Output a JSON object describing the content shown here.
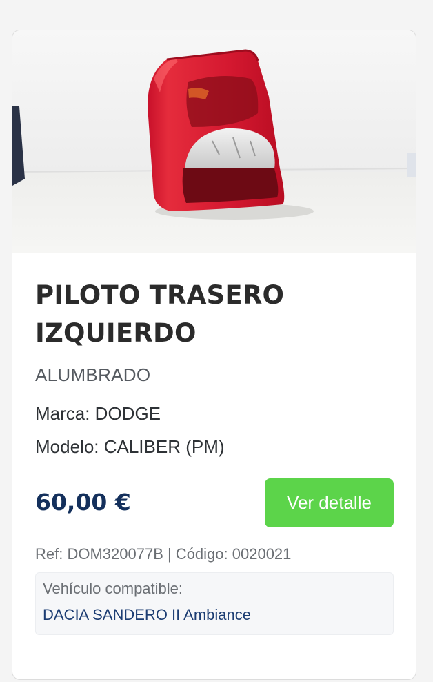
{
  "product": {
    "image_icon": "tail-light-photo",
    "title_line1": "PILOTO TRASERO",
    "title_line2": "IZQUIERDO",
    "category": "ALUMBRADO",
    "brand": "Marca: DODGE",
    "model": "Modelo: CALIBER (PM)",
    "price": "60,00 €",
    "detail_button_label": "Ver detalle",
    "reference": "Ref: DOM320077B | Código: 0020021",
    "compatible_label": "Vehículo compatible:",
    "compatible_vehicle": "DACIA SANDERO II Ambiance"
  },
  "colors": {
    "price": "#14305c",
    "button": "#5cd44a",
    "vehicle_link": "#1c3d73"
  }
}
